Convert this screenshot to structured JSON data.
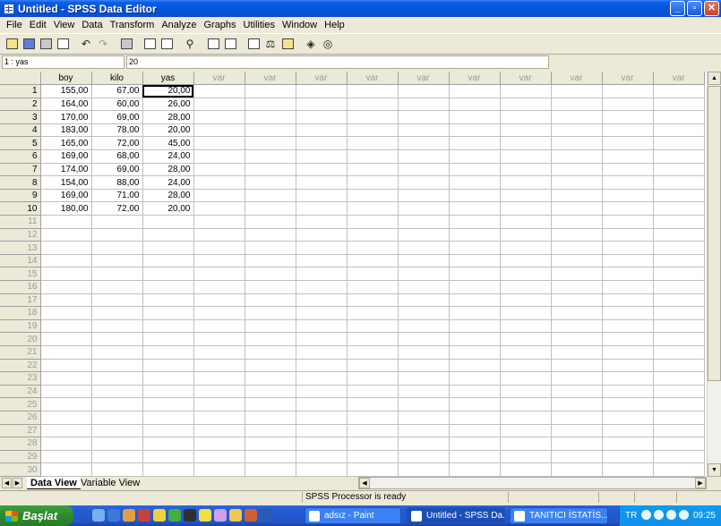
{
  "window": {
    "title": "Untitled - SPSS Data Editor",
    "controls": [
      "_",
      "▫",
      "✕"
    ]
  },
  "menu": [
    "File",
    "Edit",
    "View",
    "Data",
    "Transform",
    "Analyze",
    "Graphs",
    "Utilities",
    "Window",
    "Help"
  ],
  "toolbar_icons": [
    "open-icon",
    "save-icon",
    "print-icon",
    "dialog-recall-icon",
    "undo-icon",
    "redo-icon",
    "goto-chart-icon",
    "goto-case-icon",
    "variables-icon",
    "find-icon",
    "insert-case-icon",
    "insert-variable-icon",
    "split-file-icon",
    "weight-cases-icon",
    "select-cases-icon",
    "value-labels-icon",
    "use-sets-icon"
  ],
  "cell_editor": {
    "name": "1 : yas",
    "value": "20"
  },
  "grid": {
    "columns": [
      "boy",
      "kilo",
      "yas",
      "var",
      "var",
      "var",
      "var",
      "var",
      "var",
      "var",
      "var",
      "var",
      "var"
    ],
    "rows": [
      [
        "155,00",
        "67,00",
        "20,00"
      ],
      [
        "164,00",
        "60,00",
        "26,00"
      ],
      [
        "170,00",
        "69,00",
        "28,00"
      ],
      [
        "183,00",
        "78,00",
        "20,00"
      ],
      [
        "165,00",
        "72,00",
        "45,00"
      ],
      [
        "169,00",
        "68,00",
        "24,00"
      ],
      [
        "174,00",
        "69,00",
        "28,00"
      ],
      [
        "154,00",
        "88,00",
        "24,00"
      ],
      [
        "169,00",
        "71,00",
        "28,00"
      ],
      [
        "180,00",
        "72,00",
        "20,00"
      ]
    ],
    "row_numbers": [
      "1",
      "2",
      "3",
      "4",
      "5",
      "6",
      "7",
      "8",
      "9",
      "10",
      "11",
      "12",
      "13",
      "14",
      "15",
      "16",
      "17",
      "18",
      "19",
      "20",
      "21",
      "22",
      "23",
      "24",
      "25",
      "26",
      "27",
      "28",
      "29",
      "30"
    ]
  },
  "tabs": {
    "active": "Data View",
    "inactive": "Variable View"
  },
  "status": {
    "text": "SPSS Processor  is ready"
  },
  "taskbar": {
    "start_label": "Başlat",
    "tasks": [
      "adsız - Paint",
      "Untitled - SPSS Da...",
      "TANITICI İSTATİS..."
    ],
    "language": "TR",
    "clock": "09:25"
  }
}
